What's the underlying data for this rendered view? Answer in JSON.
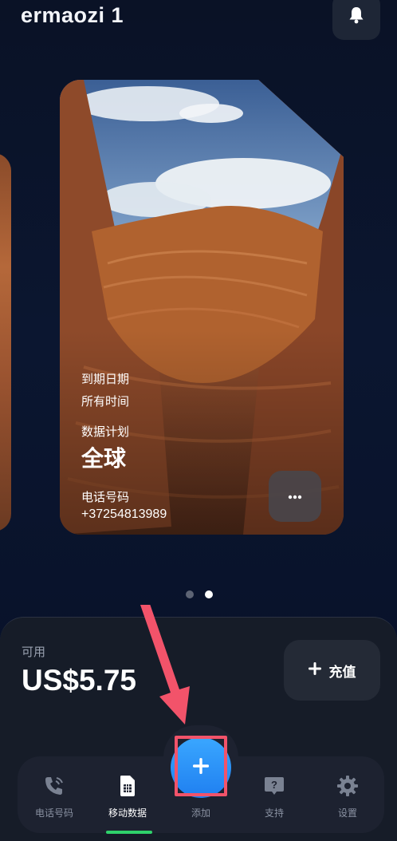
{
  "header": {
    "title": "ermaozi 1",
    "bell_icon": "bell-icon"
  },
  "card": {
    "expiry_label": "到期日期",
    "expiry_value": "所有时间",
    "plan_label": "数据计划",
    "plan_value": "全球",
    "phone_label": "电话号码",
    "phone_value": "+37254813989",
    "more_label": "•••"
  },
  "pagination": {
    "count": 2,
    "active_index": 1
  },
  "balance": {
    "label": "可用",
    "amount": "US$5.75",
    "topup_label": "充值"
  },
  "nav": {
    "items": [
      {
        "label": "电话号码",
        "icon": "phone-icon"
      },
      {
        "label": "移动数据",
        "icon": "sim-card-icon"
      },
      {
        "label": "添加",
        "icon": "plus-icon"
      },
      {
        "label": "支持",
        "icon": "help-icon"
      },
      {
        "label": "设置",
        "icon": "gear-icon"
      }
    ],
    "active_index": 1
  },
  "colors": {
    "accent_blue": "#2a94ff",
    "active_green": "#2fd26b",
    "highlight_red": "#f2536a"
  }
}
